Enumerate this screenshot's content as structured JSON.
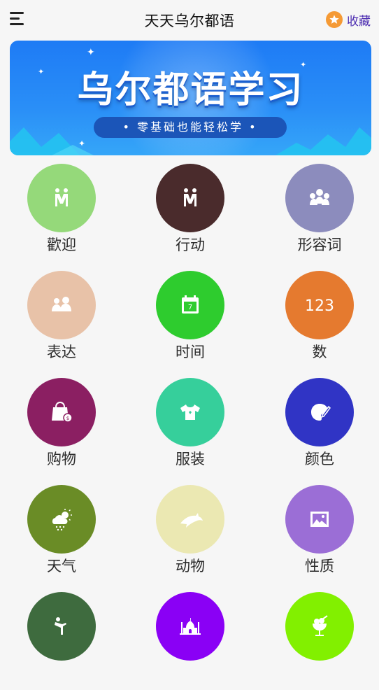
{
  "header": {
    "title": "天天乌尔都语",
    "favorite_label": "收藏"
  },
  "banner": {
    "title": "乌尔都语学习",
    "subtitle": "• 零基础也能轻松学 •"
  },
  "categories": [
    {
      "label": "歡迎",
      "icon": "two-people-icon",
      "color": "#95d97a"
    },
    {
      "label": "行动",
      "icon": "two-people-icon",
      "color": "#4a2b2c"
    },
    {
      "label": "形容词",
      "icon": "group-icon",
      "color": "#8c8cbd"
    },
    {
      "label": "表达",
      "icon": "couple-icon",
      "color": "#e8c2a8"
    },
    {
      "label": "时间",
      "icon": "calendar-icon",
      "color": "#2ecc2e"
    },
    {
      "label": "数",
      "icon": "numbers-icon",
      "color": "#e57a2f"
    },
    {
      "label": "购物",
      "icon": "shopping-bag-icon",
      "color": "#8b1f62"
    },
    {
      "label": "服装",
      "icon": "tshirt-icon",
      "color": "#36cf9b"
    },
    {
      "label": "颜色",
      "icon": "palette-icon",
      "color": "#3034c5"
    },
    {
      "label": "天气",
      "icon": "weather-icon",
      "color": "#6a8c26"
    },
    {
      "label": "动物",
      "icon": "dolphin-icon",
      "color": "#ebe8b2"
    },
    {
      "label": "性质",
      "icon": "picture-icon",
      "color": "#9b6ed6"
    },
    {
      "label": "",
      "icon": "person-bowing-icon",
      "color": "#3e6b3e"
    },
    {
      "label": "",
      "icon": "taj-mahal-icon",
      "color": "#8a00f5"
    },
    {
      "label": "",
      "icon": "dessert-icon",
      "color": "#82f000"
    }
  ]
}
